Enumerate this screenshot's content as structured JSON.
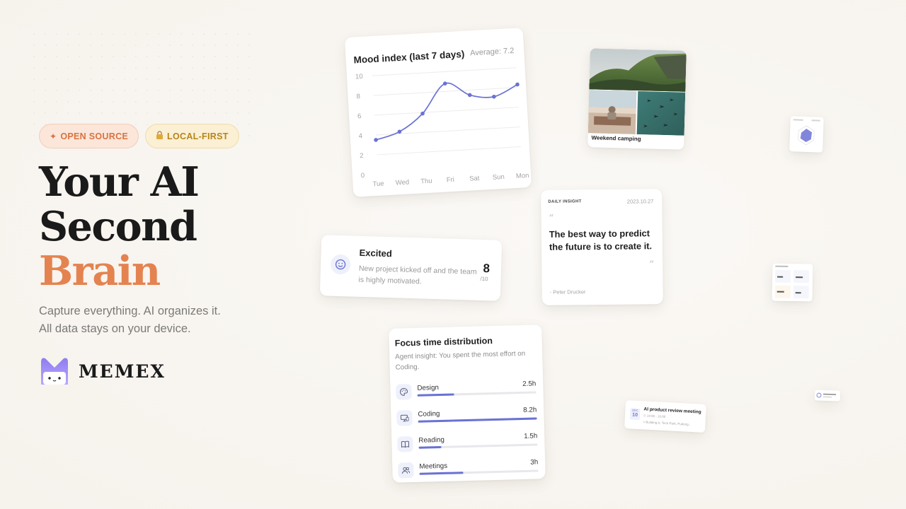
{
  "badges": {
    "open_source": "OPEN SOURCE",
    "open_source_icon": "sparkle-icon",
    "local_first": "LOCAL-FIRST",
    "local_first_icon": "lock-icon"
  },
  "hero": {
    "line1": "Your AI",
    "line2": "Second",
    "line3": "Brain",
    "accent_color": "#e48350"
  },
  "tagline": {
    "line1": "Capture everything. AI organizes it.",
    "line2": "All data stays on your device."
  },
  "brand": {
    "name": "MEMEX",
    "logo_icon": "memex-m-logo"
  },
  "mood_card": {
    "title": "Mood index (last 7 days)",
    "average": "Average: 7.2",
    "accent": "#6a72d4"
  },
  "chart_data": {
    "type": "line",
    "title": "Mood index (last 7 days)",
    "categories": [
      "Tue",
      "Wed",
      "Thu",
      "Fri",
      "Sat",
      "Sun",
      "Mon"
    ],
    "values": [
      3.5,
      4.2,
      5.9,
      8.8,
      7.5,
      7.2,
      8.3
    ],
    "yticks": [
      "10",
      "8",
      "6",
      "4",
      "2",
      "0"
    ],
    "ylim": [
      0,
      10
    ],
    "grid": true
  },
  "camping": {
    "caption": "Weekend camping"
  },
  "quote": {
    "label": "DAILY INSIGHT",
    "date": "2023.10.27",
    "text": "The best way to predict the future is to create it.",
    "author": "- Peter Drucker"
  },
  "mood_entry": {
    "title": "Excited",
    "description": "New project kicked off and the team is highly motivated.",
    "score": "8",
    "out_of": "/10",
    "icon": "smile-icon"
  },
  "focus": {
    "title": "Focus time distribution",
    "insight": "Agent insight: You spent the most effort on Coding.",
    "rows": [
      {
        "name": "Design",
        "value": "2.5h",
        "fraction": 0.31,
        "icon": "palette-icon"
      },
      {
        "name": "Coding",
        "value": "8.2h",
        "fraction": 1.0,
        "icon": "monitor-icon"
      },
      {
        "name": "Reading",
        "value": "1.5h",
        "fraction": 0.19,
        "icon": "book-icon"
      },
      {
        "name": "Meetings",
        "value": "3h",
        "fraction": 0.37,
        "icon": "people-icon"
      }
    ]
  },
  "meeting": {
    "month": "DEC",
    "day": "10",
    "title": "AI product review meeting",
    "time": "⏱ 14:00 - 16:00",
    "location": "⌖ Building A, Tech Park, Pudong..."
  }
}
